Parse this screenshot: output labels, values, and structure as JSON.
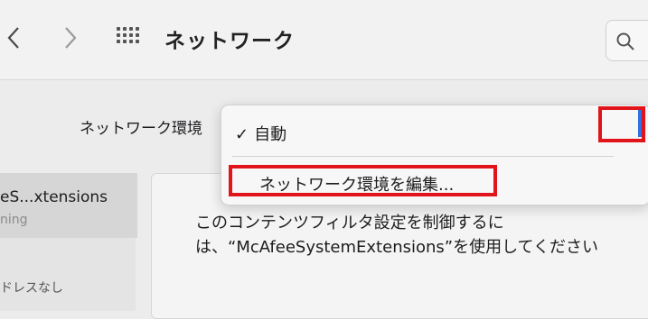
{
  "toolbar": {
    "title": "ネットワーク",
    "back_icon": "chevron-left-icon",
    "forward_icon": "chevron-right-icon",
    "grid_icon": "grid-icon",
    "search_icon": "search-icon"
  },
  "location": {
    "label": "ネットワーク環境"
  },
  "location_menu": {
    "items": [
      {
        "label": "自動",
        "checked": true
      },
      {
        "label": "ネットワーク環境を編集..."
      }
    ]
  },
  "sidebar": {
    "items": [
      {
        "name": "eS...xtensions",
        "status": "ning"
      },
      {
        "status": "ドレスなし"
      }
    ]
  },
  "detail": {
    "line1": "このコンテンツフィルタ設定を制御するに",
    "line2": "は、“McAfeeSystemExtensions”を使用してください"
  },
  "colors": {
    "highlight": "#e2141b",
    "accent": "#2f6fe0"
  }
}
